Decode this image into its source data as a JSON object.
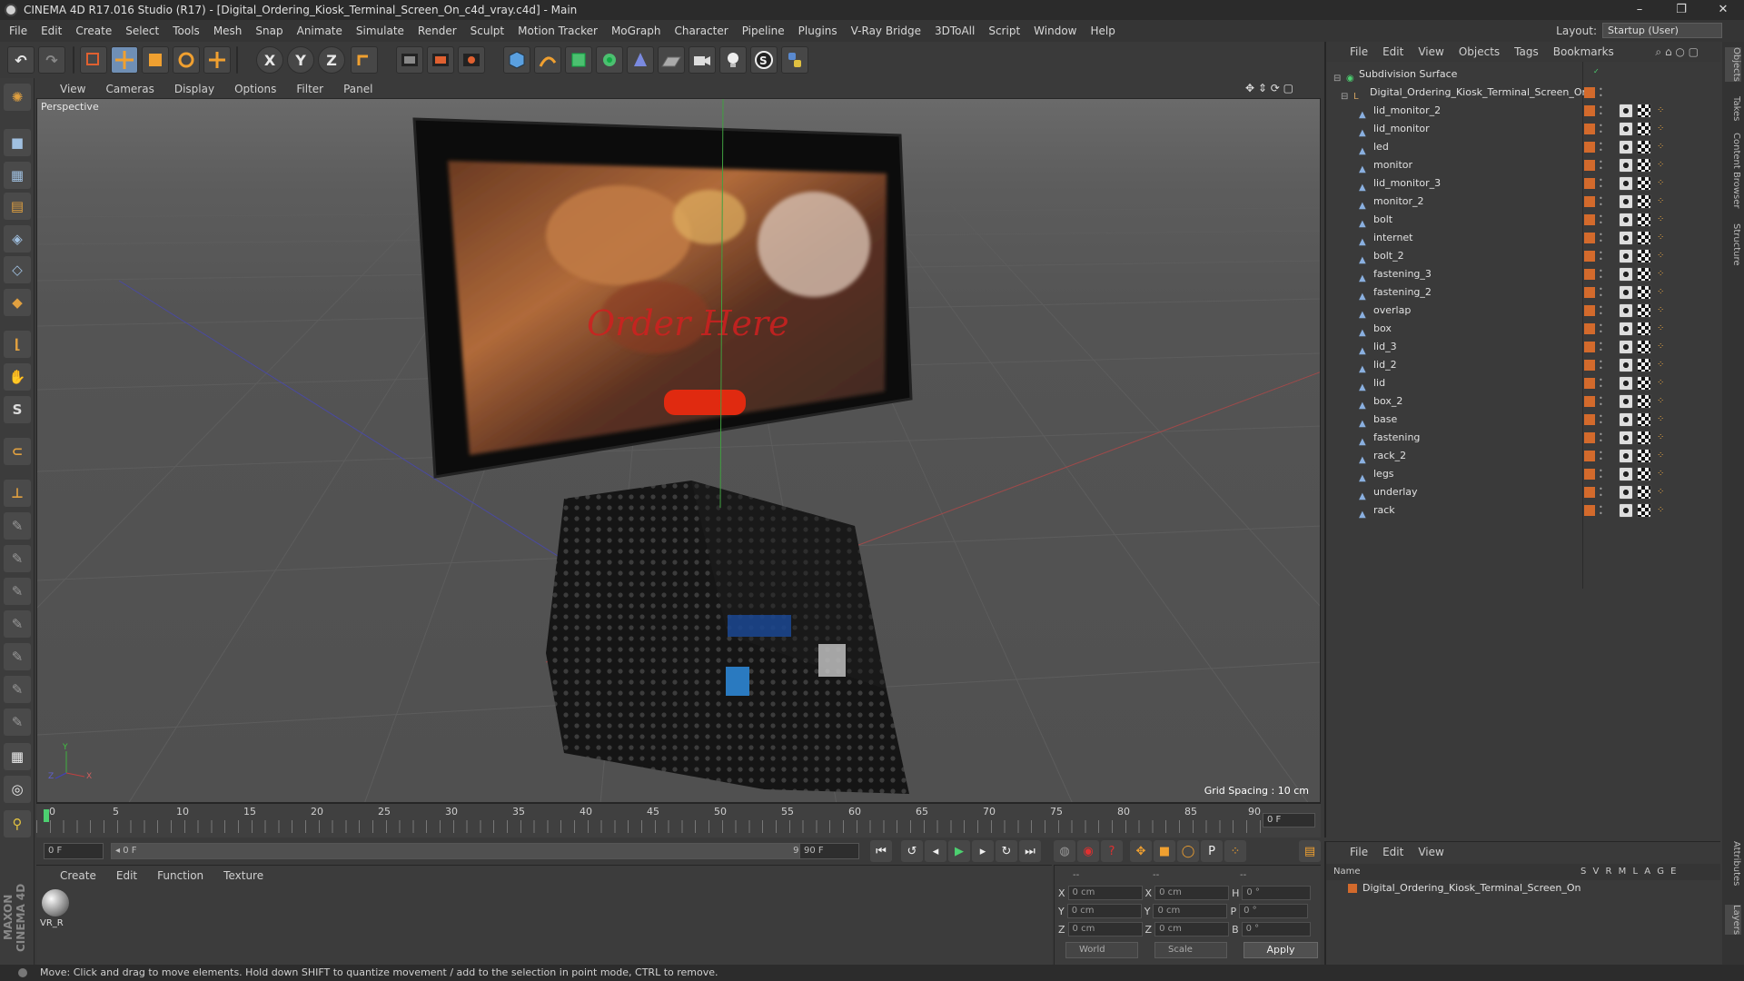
{
  "window": {
    "title": "CINEMA 4D R17.016 Studio (R17) - [Digital_Ordering_Kiosk_Terminal_Screen_On_c4d_vray.c4d] - Main",
    "minimize": "–",
    "restore": "❐",
    "close": "✕"
  },
  "menu": [
    "File",
    "Edit",
    "Create",
    "Select",
    "Tools",
    "Mesh",
    "Snap",
    "Animate",
    "Simulate",
    "Render",
    "Sculpt",
    "Motion Tracker",
    "MoGraph",
    "Character",
    "Pipeline",
    "Plugins",
    "V-Ray Bridge",
    "3DToAll",
    "Script",
    "Window",
    "Help"
  ],
  "layout": {
    "label": "Layout:",
    "value": "Startup (User)"
  },
  "toolbar": {
    "undo": "↶",
    "redo": "↷",
    "axis_x": "X",
    "axis_y": "Y",
    "axis_z": "Z"
  },
  "viewport": {
    "menu": [
      "View",
      "Cameras",
      "Display",
      "Options",
      "Filter",
      "Panel"
    ],
    "camera_label": "Perspective",
    "grid_spacing": "Grid Spacing : 10 cm",
    "screen_text": "Order Here",
    "axis_y": "Y",
    "axis_z": "Z",
    "axis_x": "X"
  },
  "timeline": {
    "ticks": [
      "0",
      "5",
      "10",
      "15",
      "20",
      "25",
      "30",
      "35",
      "40",
      "45",
      "50",
      "55",
      "60",
      "65",
      "70",
      "75",
      "80",
      "85",
      "90"
    ],
    "current_frame": "0 F"
  },
  "transport": {
    "start_field": "0 F",
    "range_start": "◂ 0 F",
    "range_end": "90 F ▸",
    "end_field": "90 F"
  },
  "materials": {
    "menu": [
      "Create",
      "Edit",
      "Function",
      "Texture"
    ],
    "items": [
      {
        "label": "VR_R"
      }
    ]
  },
  "coordinates": {
    "header_cols": [
      "--",
      "--",
      "--"
    ],
    "rows": [
      {
        "a": "X",
        "av": "0 cm",
        "b": "X",
        "bv": "0 cm",
        "c": "H",
        "cv": "0 °"
      },
      {
        "a": "Y",
        "av": "0 cm",
        "b": "Y",
        "bv": "0 cm",
        "c": "P",
        "cv": "0 °"
      },
      {
        "a": "Z",
        "av": "0 cm",
        "b": "Z",
        "bv": "0 cm",
        "c": "B",
        "cv": "0 °"
      }
    ],
    "mode": "World",
    "scale": "Scale",
    "apply": "Apply"
  },
  "objects": {
    "menu": [
      "File",
      "Edit",
      "View",
      "Objects",
      "Tags",
      "Bookmarks"
    ],
    "root": "Subdivision Surface",
    "group": "Digital_Ordering_Kiosk_Terminal_Screen_On",
    "children": [
      "lid_monitor_2",
      "lid_monitor",
      "led",
      "monitor",
      "lid_monitor_3",
      "monitor_2",
      "bolt",
      "internet",
      "bolt_2",
      "fastening_3",
      "fastening_2",
      "overlap",
      "box",
      "lid_3",
      "lid_2",
      "lid",
      "box_2",
      "base",
      "fastening",
      "rack_2",
      "legs",
      "underlay",
      "rack"
    ]
  },
  "layers": {
    "menu": [
      "File",
      "Edit",
      "View"
    ],
    "name_col": "Name",
    "cols": "S V R M L A G E",
    "row": "Digital_Ordering_Kiosk_Terminal_Screen_On"
  },
  "right_tabs": [
    "Objects",
    "Takes",
    "Content Browser",
    "Structure",
    "Attributes",
    "Layers"
  ],
  "status": "Move: Click and drag to move elements. Hold down SHIFT to quantize movement / add to the selection in point mode, CTRL to remove.",
  "brand": "MAXON CINEMA 4D",
  "colors": {
    "accent": "#d36a2c",
    "active_tool": "#6f8fb5"
  }
}
